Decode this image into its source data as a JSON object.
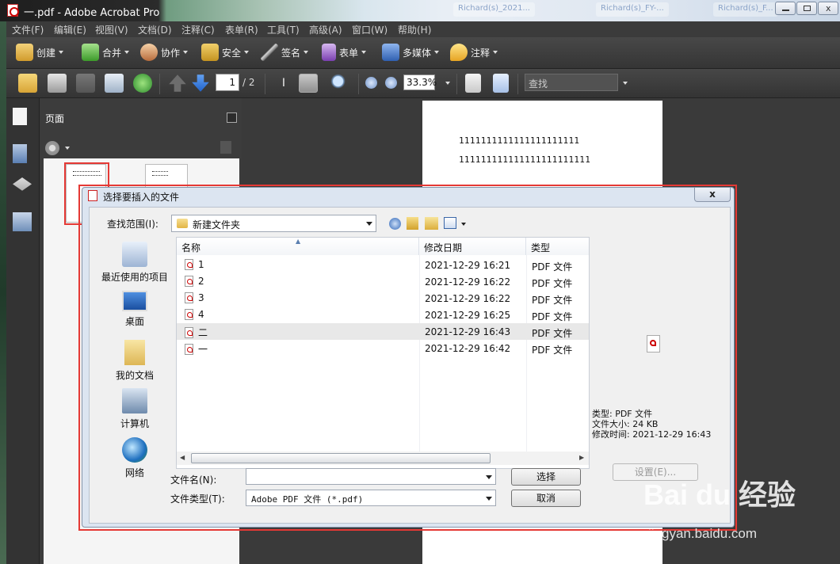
{
  "window": {
    "title": "一.pdf - Adobe Acrobat Pro",
    "ghost_tabs": [
      "Richard(s)_2021...",
      "Richard(s)_FY-...",
      "Richard(s)_F..."
    ]
  },
  "menu": [
    "文件(F)",
    "编辑(E)",
    "视图(V)",
    "文档(D)",
    "注释(C)",
    "表单(R)",
    "工具(T)",
    "高级(A)",
    "窗口(W)",
    "帮助(H)"
  ],
  "toolbar1": {
    "create": "创建",
    "combine": "合并",
    "collaborate": "协作",
    "secure": "安全",
    "sign": "签名",
    "forms": "表单",
    "multimedia": "多媒体",
    "comment": "注释"
  },
  "toolbar2": {
    "page_current": "1",
    "page_total": "/ 2",
    "zoom": "33.3%",
    "find_placeholder": "查找"
  },
  "pages_panel": {
    "title": "页面"
  },
  "document": {
    "line1": "1111111111111111111111",
    "line2": "111111111111111111111111"
  },
  "dialog": {
    "title": "选择要插入的文件",
    "look_in_label": "查找范围(I):",
    "look_in_value": "新建文件夹",
    "places": [
      {
        "label": "最近使用的项目",
        "icon": "recent-items-icon"
      },
      {
        "label": "桌面",
        "icon": "desktop-icon"
      },
      {
        "label": "我的文档",
        "icon": "my-documents-icon"
      },
      {
        "label": "计算机",
        "icon": "computer-icon"
      },
      {
        "label": "网络",
        "icon": "network-icon"
      }
    ],
    "columns": {
      "name": "名称",
      "date": "修改日期",
      "type": "类型"
    },
    "files": [
      {
        "name": "1",
        "date": "2021-12-29 16:21",
        "type": "PDF 文件"
      },
      {
        "name": "2",
        "date": "2021-12-29 16:22",
        "type": "PDF 文件"
      },
      {
        "name": "3",
        "date": "2021-12-29 16:22",
        "type": "PDF 文件"
      },
      {
        "name": "4",
        "date": "2021-12-29 16:25",
        "type": "PDF 文件"
      },
      {
        "name": "二",
        "date": "2021-12-29 16:43",
        "type": "PDF 文件"
      },
      {
        "name": "一",
        "date": "2021-12-29 16:42",
        "type": "PDF 文件"
      }
    ],
    "selected_index": 4,
    "preview": {
      "type": "类型: PDF 文件",
      "size": "文件大小: 24 KB",
      "modified": "修改时间: 2021-12-29 16:43"
    },
    "settings_button": "设置(E)...",
    "filename_label": "文件名(N):",
    "filename_value": "",
    "filetype_label": "文件类型(T):",
    "filetype_value": "Adobe PDF 文件 (*.pdf)",
    "select_button": "选择",
    "cancel_button": "取消",
    "close_glyph": "x"
  },
  "watermark": {
    "brand": "Bai du 经验",
    "url": "jingyan.baidu.com"
  }
}
